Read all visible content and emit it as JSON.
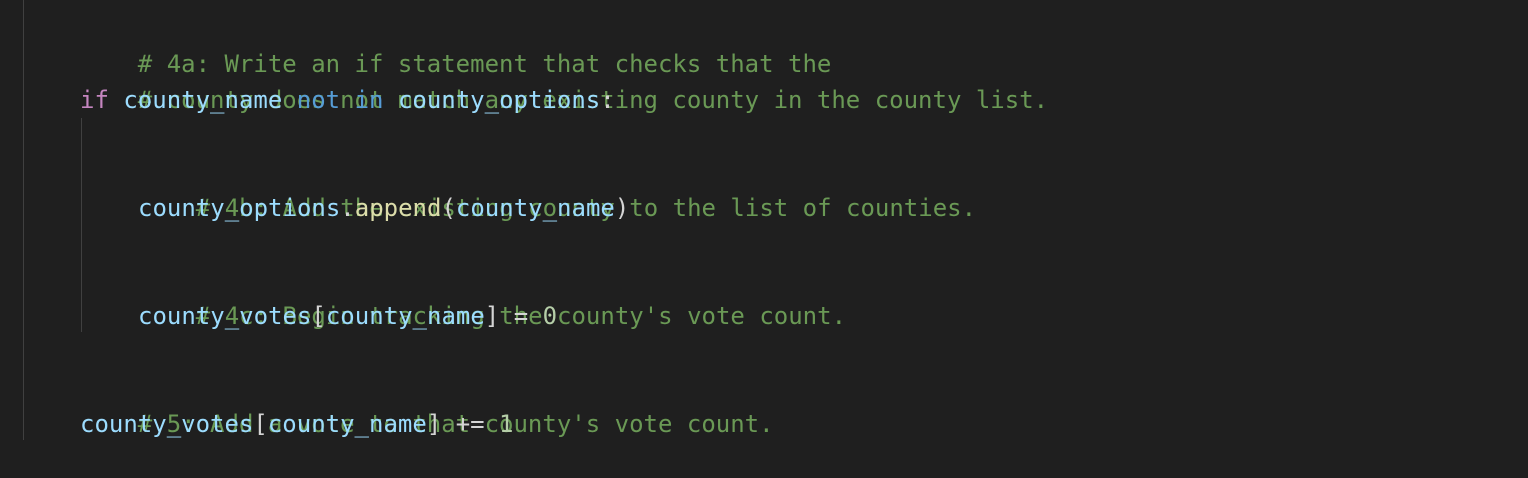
{
  "code": {
    "line1": {
      "comment": "# 4a: Write an if statement that checks that the"
    },
    "line2": {
      "comment": "# county does not match any existing county in the county list."
    },
    "line3": {
      "kw_if": "if",
      "var1": "county_name",
      "kw_not": "not",
      "kw_in": "in",
      "var2": "county_options",
      "colon": ":"
    },
    "line5": {
      "comment": "# 4b: Add the existing county to the list of counties."
    },
    "line6": {
      "var1": "county_options",
      "dot": ".",
      "method": "append",
      "open": "(",
      "arg": "county_name",
      "close": ")"
    },
    "line8": {
      "comment": "# 4c: Begin tracking the county's vote count."
    },
    "line9": {
      "var1": "county_votes",
      "open": "[",
      "key": "county_name",
      "close": "]",
      "op": " = ",
      "num": "0"
    },
    "line11": {
      "comment": "# 5: Add a vote to that county's vote count."
    },
    "line12": {
      "var1": "county_votes",
      "open": "[",
      "key": "county_name",
      "close": "]",
      "op": " += ",
      "num": "1"
    }
  },
  "colors": {
    "background": "#1f1f1f",
    "comment": "#6a9955",
    "keyword_control": "#c586c0",
    "keyword_operator": "#569cd6",
    "variable": "#9cdcfe",
    "function": "#dcdcaa",
    "number": "#b5cea8",
    "punctuation": "#d4d4d4"
  }
}
